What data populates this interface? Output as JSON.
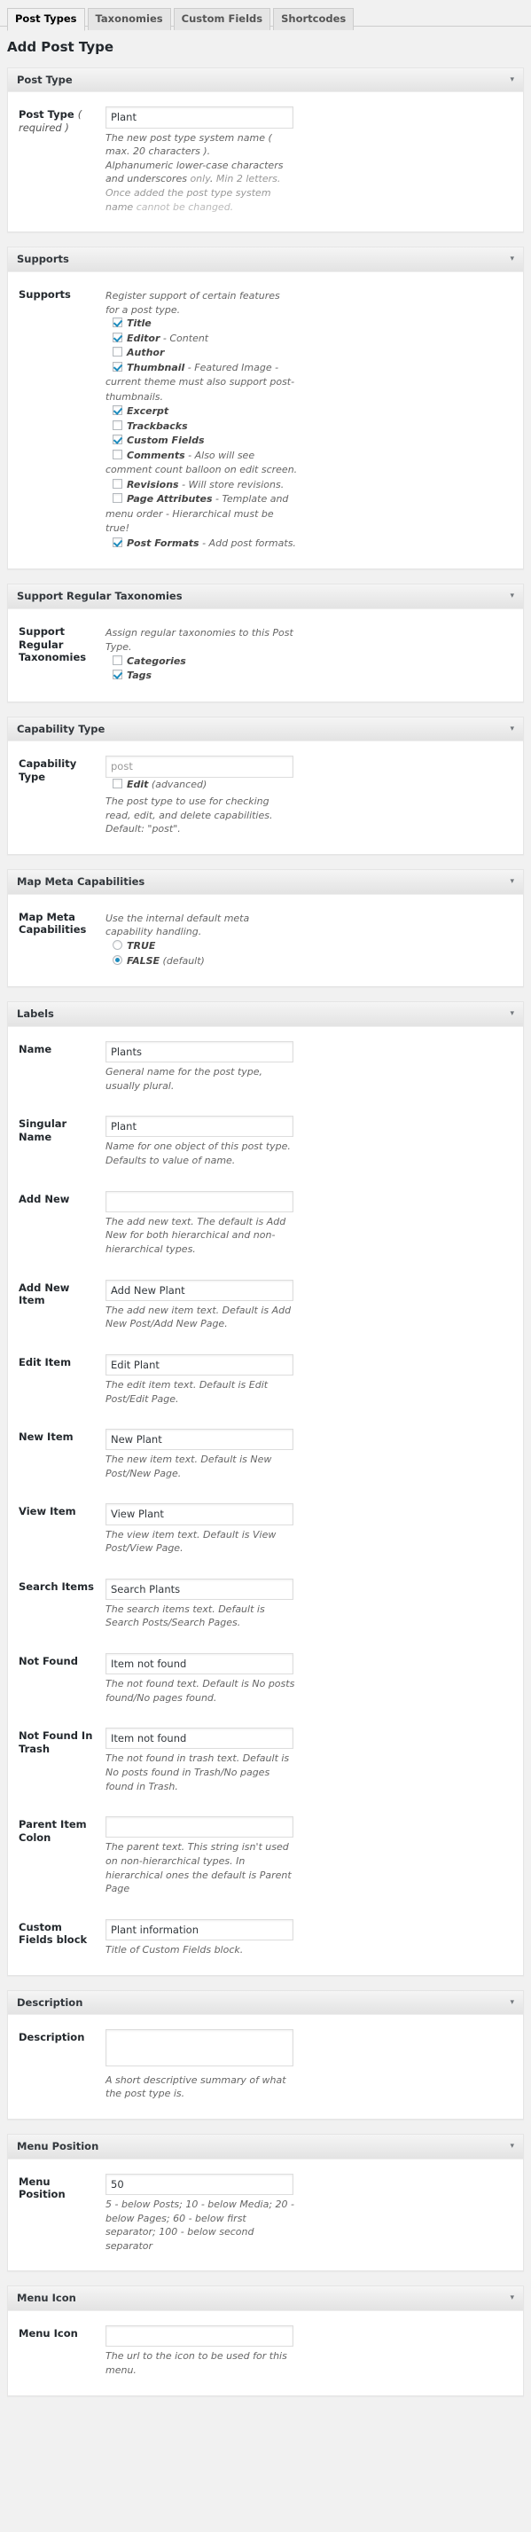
{
  "tabs": [
    {
      "label": "Post Types",
      "active": true
    },
    {
      "label": "Taxonomies",
      "active": false
    },
    {
      "label": "Custom Fields",
      "active": false
    },
    {
      "label": "Shortcodes",
      "active": false
    }
  ],
  "page_title": "Add Post Type",
  "toggle_glyph": "▾",
  "sections": {
    "post_type": {
      "title": "Post Type",
      "label": "Post Type",
      "label_suffix": "( required )",
      "value": "Plant",
      "desc_1": "The new post type system name ( max. 20 characters ).",
      "desc_2a": "Alphanumeric lower-case characters and underscores ",
      "desc_2b": "only",
      "desc_2c": ". ",
      "desc_2d": "Min 2 letters. Once added the post type system name ",
      "desc_2e": "cannot be changed."
    },
    "supports": {
      "title": "Supports",
      "label": "Supports",
      "desc": "Register support of certain features for a post type.",
      "options": [
        {
          "label": "Title",
          "sub": "",
          "checked": true
        },
        {
          "label": "Editor",
          "sub": " - Content",
          "checked": true
        },
        {
          "label": "Author",
          "sub": "",
          "checked": false
        },
        {
          "label": "Thumbnail",
          "sub": " - Featured Image - current theme must also support post-thumbnails.",
          "checked": true
        },
        {
          "label": "Excerpt",
          "sub": "",
          "checked": true
        },
        {
          "label": "Trackbacks",
          "sub": "",
          "checked": false
        },
        {
          "label": "Custom Fields",
          "sub": "",
          "checked": true
        },
        {
          "label": "Comments",
          "sub": " - Also will see comment count balloon on edit screen.",
          "checked": false
        },
        {
          "label": "Revisions",
          "sub": " - Will store revisions.",
          "checked": false
        },
        {
          "label": "Page Attributes",
          "sub": " - Template and menu order - Hierarchical must be true!",
          "checked": false
        },
        {
          "label": "Post Formats",
          "sub": " - Add post formats.",
          "checked": true
        }
      ]
    },
    "taxonomies": {
      "title": "Support Regular Taxonomies",
      "label": "Support Regular Taxonomies",
      "desc": "Assign regular taxonomies to this Post Type.",
      "options": [
        {
          "label": "Categories",
          "sub": "",
          "checked": false
        },
        {
          "label": "Tags",
          "sub": "",
          "checked": true
        }
      ]
    },
    "capability_type": {
      "title": "Capability Type",
      "label": "Capability Type",
      "placeholder": "post",
      "value": "",
      "edit_option": {
        "label": "Edit",
        "sub": " (advanced)",
        "checked": false
      },
      "desc": "The post type to use for checking read, edit, and delete capabilities. Default: \"post\"."
    },
    "map_meta_caps": {
      "title": "Map Meta Capabilities",
      "label": "Map Meta Capabilities",
      "desc": "Use the internal default meta capability handling.",
      "options": [
        {
          "label": "TRUE",
          "sub": "",
          "checked": false
        },
        {
          "label": "FALSE",
          "sub": " (default)",
          "checked": true
        }
      ]
    },
    "labels": {
      "title": "Labels",
      "fields": [
        {
          "label": "Name",
          "value": "Plants",
          "placeholder": "",
          "desc": "General name for the post type, usually plural."
        },
        {
          "label": "Singular Name",
          "value": "Plant",
          "placeholder": "",
          "desc": "Name for one object of this post type. Defaults to value of name."
        },
        {
          "label": "Add New",
          "value": "",
          "placeholder": "",
          "desc": "The add new text. The default is Add New for both hierarchical and non-hierarchical types."
        },
        {
          "label": "Add New Item",
          "value": "Add New Plant",
          "placeholder": "",
          "desc": "The add new item text. Default is Add New Post/Add New Page."
        },
        {
          "label": "Edit Item",
          "value": "Edit Plant",
          "placeholder": "",
          "desc": "The edit item text. Default is Edit Post/Edit Page."
        },
        {
          "label": "New Item",
          "value": "New Plant",
          "placeholder": "",
          "desc": "The new item text. Default is New Post/New Page."
        },
        {
          "label": "View Item",
          "value": "View Plant",
          "placeholder": "",
          "desc": "The view item text. Default is View Post/View Page."
        },
        {
          "label": "Search Items",
          "value": "Search Plants",
          "placeholder": "",
          "desc": "The search items text. Default is Search Posts/Search Pages."
        },
        {
          "label": "Not Found",
          "value": "Item not found",
          "placeholder": "",
          "desc": "The not found text. Default is No posts found/No pages found."
        },
        {
          "label": "Not Found In Trash",
          "value": "Item not found",
          "placeholder": "",
          "desc": "The not found in trash text. Default is No posts found in Trash/No pages found in Trash."
        },
        {
          "label": "Parent Item Colon",
          "value": "",
          "placeholder": "",
          "desc": "The parent text. This string isn't used on non-hierarchical types. In hierarchical ones the default is Parent Page"
        },
        {
          "label": "Custom Fields block",
          "value": "Plant information",
          "placeholder": "",
          "desc": "Title of Custom Fields block."
        }
      ]
    },
    "description": {
      "title": "Description",
      "label": "Description",
      "value": "",
      "desc": "A short descriptive summary of what the post type is."
    },
    "menu_position": {
      "title": "Menu Position",
      "label": "Menu Position",
      "value": "50",
      "desc": "5 - below Posts; 10 - below Media; 20 - below Pages; 60 - below first separator; 100 - below second separator"
    },
    "menu_icon": {
      "title": "Menu Icon",
      "label": "Menu Icon",
      "value": "",
      "desc": "The url to the icon to be used for this menu."
    }
  }
}
